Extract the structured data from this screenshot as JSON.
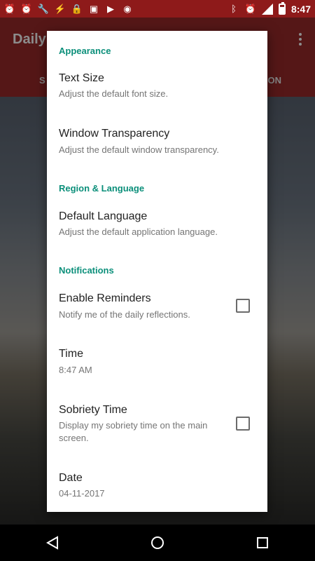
{
  "status_bar": {
    "time": "8:47",
    "left_icons": [
      "alarm-icon",
      "alarm-icon",
      "wrench-icon",
      "flash-off-icon",
      "lock-icon",
      "photo-icon",
      "play-store-icon",
      "android-icon"
    ],
    "right_icons": [
      "bluetooth-icon",
      "alarm-icon",
      "signal-icon",
      "battery-icon"
    ]
  },
  "app_bar": {
    "title": "Daily",
    "tab_left": "S",
    "tab_right": "ON"
  },
  "dialog": {
    "sections": [
      {
        "header": "Appearance",
        "items": [
          {
            "title": "Text Size",
            "summary": "Adjust the default font size."
          },
          {
            "title": "Window Transparency",
            "summary": "Adjust the default window transparency."
          }
        ]
      },
      {
        "header": "Region & Language",
        "items": [
          {
            "title": "Default Language",
            "summary": "Adjust the default application language."
          }
        ]
      },
      {
        "header": "Notifications",
        "items": [
          {
            "title": "Enable Reminders",
            "summary": "Notify me of the daily reflections.",
            "checked": false
          },
          {
            "title": "Time",
            "summary": "8:47 AM"
          },
          {
            "title": "Sobriety Time",
            "summary": "Display my sobriety time on the main screen.",
            "checked": false
          },
          {
            "title": "Date",
            "summary": "04-11-2017"
          }
        ]
      }
    ]
  },
  "colors": {
    "accent": "#0b8f7a",
    "primary": "#9c2a2a",
    "status_bar": "#8e1a1a"
  }
}
